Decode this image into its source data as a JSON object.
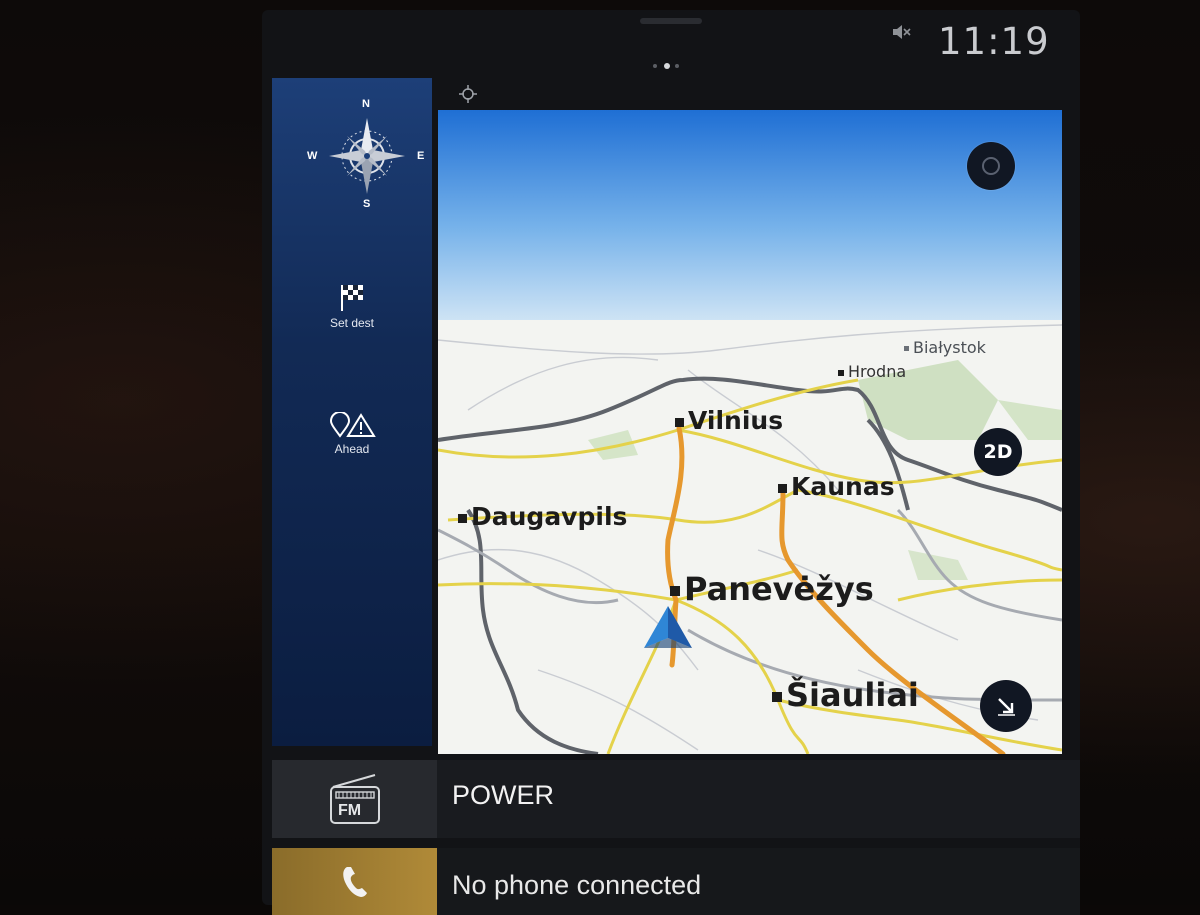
{
  "status_bar": {
    "time": "11:19",
    "volume_icon": "muted-speaker-icon"
  },
  "sidebar": {
    "compass": {
      "icon": "compass-rose-icon",
      "north": "N",
      "south": "S",
      "east": "E",
      "west": "W"
    },
    "set_destination": {
      "icon": "checkered-flag-icon",
      "label": "Set dest"
    },
    "ahead": {
      "icon": "pin-warning-icon",
      "label": "Ahead"
    }
  },
  "map": {
    "cities": [
      {
        "name": "Białystok"
      },
      {
        "name": "Hrodna"
      },
      {
        "name": "Vilnius"
      },
      {
        "name": "Kaunas"
      },
      {
        "name": "Daugavpils"
      },
      {
        "name": "Panevėžys"
      },
      {
        "name": "Šiauliai"
      }
    ],
    "view_mode_label": "2D",
    "top_button_icon": "overflow-icon",
    "expand_icon": "collapse-arrow-icon",
    "vehicle_icon": "vehicle-position-arrow-icon",
    "locate_icon": "locate-crosshair-icon"
  },
  "tiles": {
    "radio": {
      "icon": "fm-radio-icon",
      "icon_text": "FM",
      "label": "POWER"
    },
    "phone": {
      "icon": "phone-handset-icon",
      "label": "No phone connected"
    }
  },
  "colors": {
    "sidebar_top": "#1d3f78",
    "sky": "#2f7fd8",
    "major_road": "#e6982e",
    "secondary_road": "#e6d246",
    "border": "#585c62",
    "phone_accent": "#b08a38"
  }
}
